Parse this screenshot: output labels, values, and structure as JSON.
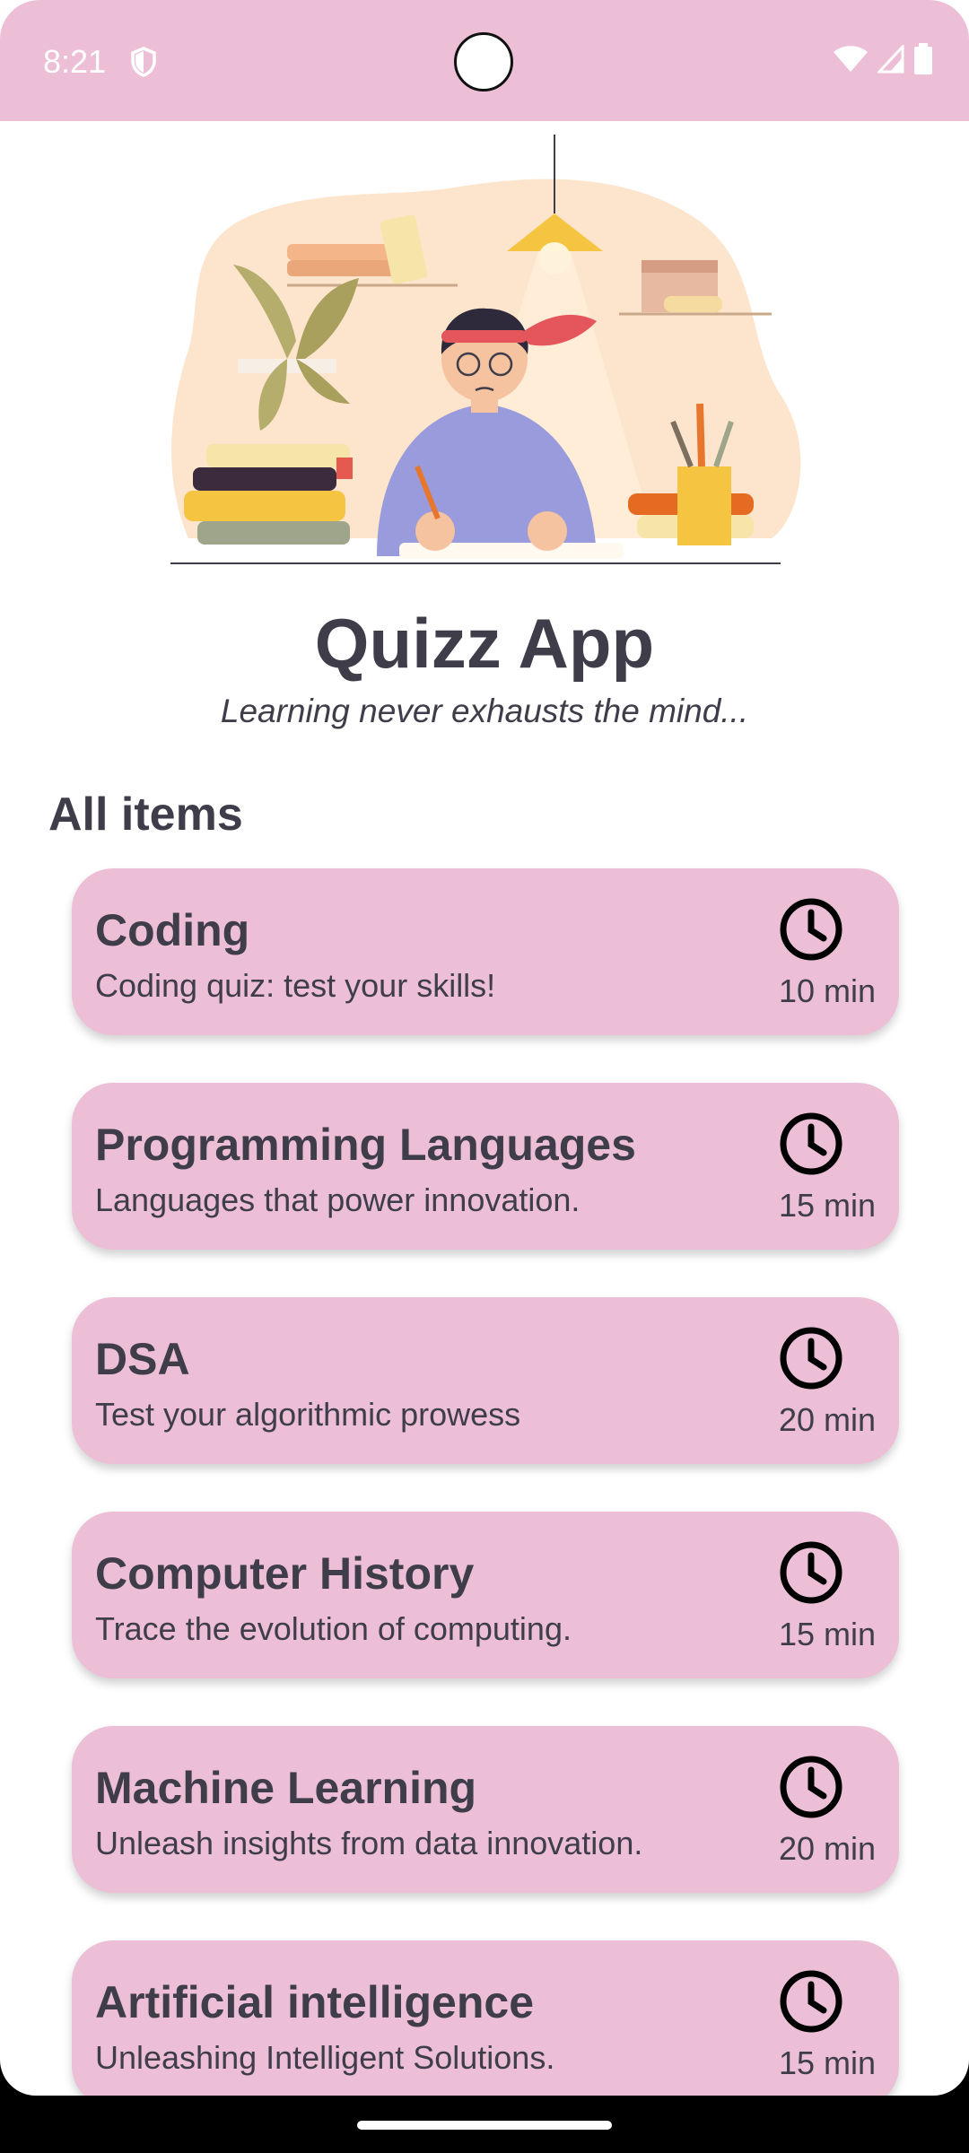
{
  "status_bar": {
    "time": "8:21",
    "icons": [
      "shield-icon",
      "wifi-icon",
      "signal-icon",
      "battery-icon"
    ]
  },
  "colors": {
    "accent": "#ecbfd6",
    "text": "#3f3d4a",
    "background": "#ffffff"
  },
  "header": {
    "title": "Quizz App",
    "subtitle": "Learning never exhausts the mind..."
  },
  "section_title": "All items",
  "items": [
    {
      "title": "Coding",
      "description": "Coding quiz: test your skills!",
      "time": "10 min",
      "icon": "clock-icon"
    },
    {
      "title": "Programming Languages",
      "description": "Languages that power innovation.",
      "time": "15 min",
      "icon": "clock-icon"
    },
    {
      "title": "DSA",
      "description": "Test your algorithmic prowess",
      "time": "20 min",
      "icon": "clock-icon"
    },
    {
      "title": "Computer History",
      "description": "Trace the evolution of computing.",
      "time": "15 min",
      "icon": "clock-icon"
    },
    {
      "title": "Machine Learning",
      "description": "Unleash insights from data innovation.",
      "time": "20 min",
      "icon": "clock-icon"
    },
    {
      "title": "Artificial intelligence",
      "description": "Unleashing Intelligent Solutions.",
      "time": "15 min",
      "icon": "clock-icon"
    }
  ]
}
